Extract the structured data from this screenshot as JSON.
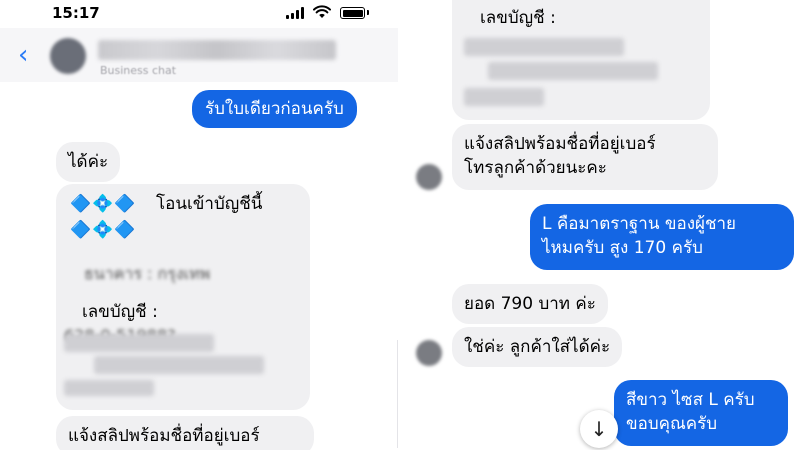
{
  "status_bar": {
    "time": "15:17"
  },
  "header": {
    "contact_subtitle": "Business chat"
  },
  "left": {
    "msg_out_1": "รับใบเดียวก่อนครับ",
    "msg_in_1": "ได้ค่ะ",
    "account_card": {
      "diamonds_1": "🔷💠🔷",
      "transfer_label": "โอนเข้าบัญชีนี้",
      "diamonds_2": "🔷💠🔷",
      "bank_label": "ธนาคาร : กรุงเทพ",
      "account_label": "เลขบัญชี :",
      "account_number": "628-0-51988?"
    },
    "msg_in_slip": "แจ้งสลิปพร้อมชื่อที่อยู่เบอร์"
  },
  "right": {
    "card_account_label": "เลขบัญชี :",
    "msg_in_slip_line1": "แจ้งสลิปพร้อมชื่อที่อยู่เบอร์",
    "msg_in_slip_line2": "โทรลูกค้าด้วยนะคะ",
    "msg_out_size_line1": "L คือมาตราฐาน ของผู้ชาย",
    "msg_out_size_line2": "ไหมครับ สูง 170 ครับ",
    "msg_in_total": "ยอด 790 บาท ค่ะ",
    "msg_in_yes": "ใช่ค่ะ ลูกค้าใส่ได้ค่ะ",
    "msg_out_color_line1": "สีขาว ไซส L ครับ",
    "msg_out_color_line2": "ขอบคุณครับ"
  },
  "icons": {
    "back": "chevron-left-icon",
    "scroll_down": "arrow-down-icon"
  }
}
